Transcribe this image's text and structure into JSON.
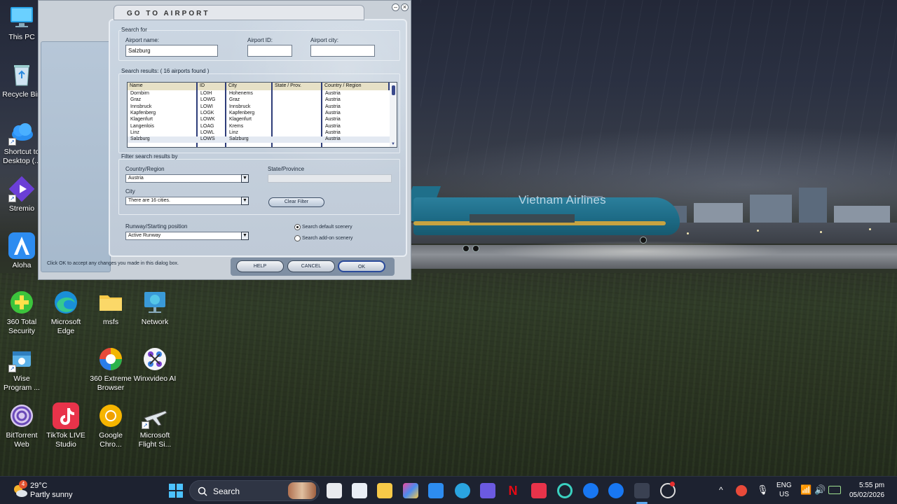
{
  "desktop_icons": [
    {
      "label": "This PC",
      "icon": "monitor-icon"
    },
    {
      "label": "Recycle Bin",
      "icon": "recycle-bin-icon"
    },
    {
      "label": "Shortcut to Desktop (...",
      "icon": "cloud-icon"
    },
    {
      "label": "Stremio",
      "icon": "stremio-icon"
    },
    {
      "label": "Aloha",
      "icon": "aloha-icon"
    },
    {
      "label": "360 Total Security",
      "icon": "shield-plus-icon"
    },
    {
      "label": "Microsoft Edge",
      "icon": "edge-icon"
    },
    {
      "label": "msfs",
      "icon": "folder-icon"
    },
    {
      "label": "Network",
      "icon": "network-icon"
    },
    {
      "label": "Wise Program ...",
      "icon": "wise-icon"
    },
    {
      "label": "360 Extreme Browser",
      "icon": "browser-icon"
    },
    {
      "label": "Winxvideo AI",
      "icon": "winxvideo-icon"
    },
    {
      "label": "BitTorrent Web",
      "icon": "bittorrent-icon"
    },
    {
      "label": "TikTok LIVE Studio",
      "icon": "tiktok-icon"
    },
    {
      "label": "Google Chro...",
      "icon": "chrome-icon"
    },
    {
      "label": "Microsoft Flight Si...",
      "icon": "flight-sim-icon"
    }
  ],
  "scene": {
    "plane_livery_text": "Vietnam Airlines"
  },
  "dialog": {
    "title": "GO TO AIRPORT",
    "search_for": {
      "group_label": "Search for",
      "airport_name_label": "Airport name:",
      "airport_name_value": "Salzburg",
      "airport_id_label": "Airport ID:",
      "airport_id_value": "",
      "airport_city_label": "Airport city:",
      "airport_city_value": ""
    },
    "results": {
      "group_label": "Search results: ( 16 airports found )",
      "columns": [
        "Name",
        "ID",
        "City",
        "State / Prov.",
        "Country / Region"
      ],
      "rows": [
        [
          "Dornbirn",
          "LOIH",
          "Hohenems",
          "",
          "Austria"
        ],
        [
          "Graz",
          "LOWG",
          "Graz",
          "",
          "Austria"
        ],
        [
          "Innsbruck",
          "LOWI",
          "Innsbruck",
          "",
          "Austria"
        ],
        [
          "Kapfenberg",
          "LOGK",
          "Kapfenberg",
          "",
          "Austria"
        ],
        [
          "Klagenfurt",
          "LOWK",
          "Klagenfurt",
          "",
          "Austria"
        ],
        [
          "Langenlois",
          "LOAG",
          "Krems",
          "",
          "Austria"
        ],
        [
          "Linz",
          "LOWL",
          "Linz",
          "",
          "Austria"
        ],
        [
          "Salzburg",
          "LOWS",
          "Salzburg",
          "",
          "Austria"
        ]
      ],
      "selected_row": 7
    },
    "filter": {
      "group_label": "Filter search results by",
      "country_label": "Country/Region",
      "country_value": "Austria",
      "state_label": "State/Province",
      "state_value": "",
      "city_label": "City",
      "city_value": "There are 16 cities.",
      "clear_filter_label": "Clear Filter"
    },
    "runway": {
      "label": "Runway/Starting position",
      "value": "Active Runway"
    },
    "scenery": {
      "default_label": "Search default scenery",
      "addon_label": "Search add-on scenery",
      "selected": "default"
    },
    "status_text": "Click OK to accept any changes you made in this dialog box.",
    "buttons": {
      "help": "HELP",
      "cancel": "CANCEL",
      "ok": "OK"
    }
  },
  "taskbar": {
    "weather_temp": "29°C",
    "weather_desc": "Partly sunny",
    "weather_badge": "4",
    "search_placeholder": "Search",
    "lang_line1": "ENG",
    "lang_line2": "US",
    "time": "5:55 pm",
    "date": "05/02/2026"
  }
}
